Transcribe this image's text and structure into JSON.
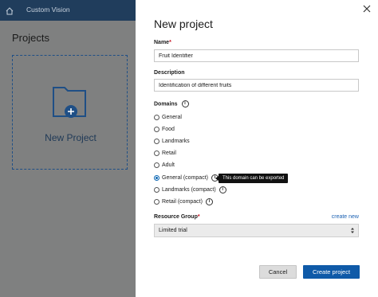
{
  "app": {
    "title": "Custom Vision"
  },
  "background": {
    "projects_title": "Projects",
    "new_project_label": "New Project"
  },
  "dialog": {
    "title": "New project",
    "name_label": "Name",
    "name_value": "Fruit Identifier",
    "description_label": "Description",
    "description_value": "Identification of different fruits",
    "domains_label": "Domains",
    "domains": [
      {
        "label": "General",
        "checked": false,
        "info": false
      },
      {
        "label": "Food",
        "checked": false,
        "info": false
      },
      {
        "label": "Landmarks",
        "checked": false,
        "info": false
      },
      {
        "label": "Retail",
        "checked": false,
        "info": false
      },
      {
        "label": "Adult",
        "checked": false,
        "info": false
      },
      {
        "label": "General (compact)",
        "checked": true,
        "info": true
      },
      {
        "label": "Landmarks (compact)",
        "checked": false,
        "info": true
      },
      {
        "label": "Retail (compact)",
        "checked": false,
        "info": true
      }
    ],
    "tooltip": "This domain can be exported",
    "resource_group_label": "Resource Group",
    "create_new_label": "create new",
    "resource_group_value": "Limited trial",
    "cancel_label": "Cancel",
    "create_label": "Create project"
  },
  "colors": {
    "topbar": "#203d5c",
    "primary_button": "#0f5aa8",
    "link": "#1c62b3",
    "required": "#c50f1f"
  }
}
